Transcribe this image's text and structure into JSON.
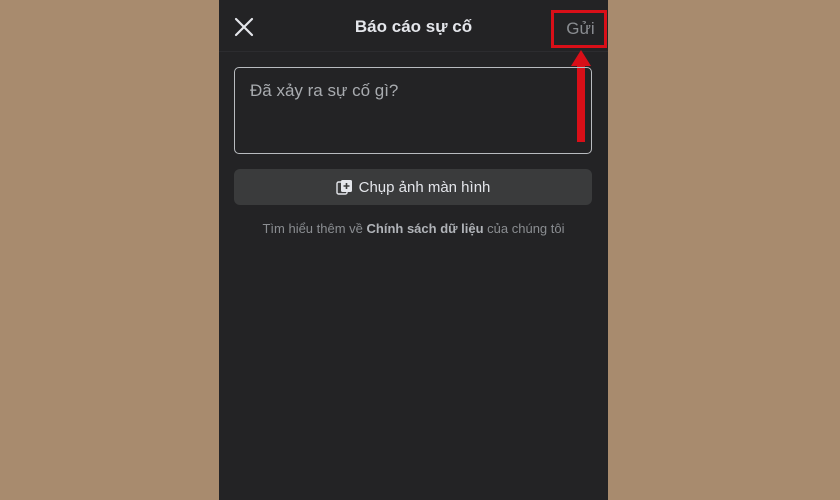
{
  "header": {
    "title": "Báo cáo sự cố",
    "send_label": "Gửi",
    "close_icon": "close-icon"
  },
  "report": {
    "placeholder": "Đã xảy ra sự cố gì?"
  },
  "screenshot_button": {
    "label": "Chụp ảnh màn hình",
    "icon": "add-photo-icon"
  },
  "policy": {
    "prefix": "Tìm hiểu thêm về ",
    "link": "Chính sách dữ liệu",
    "suffix": " của chúng tôi"
  },
  "colors": {
    "page_background": "#a88b6e",
    "panel_background": "#232325",
    "annotation_red": "#d90f18",
    "send_text": "#8a8d91"
  }
}
